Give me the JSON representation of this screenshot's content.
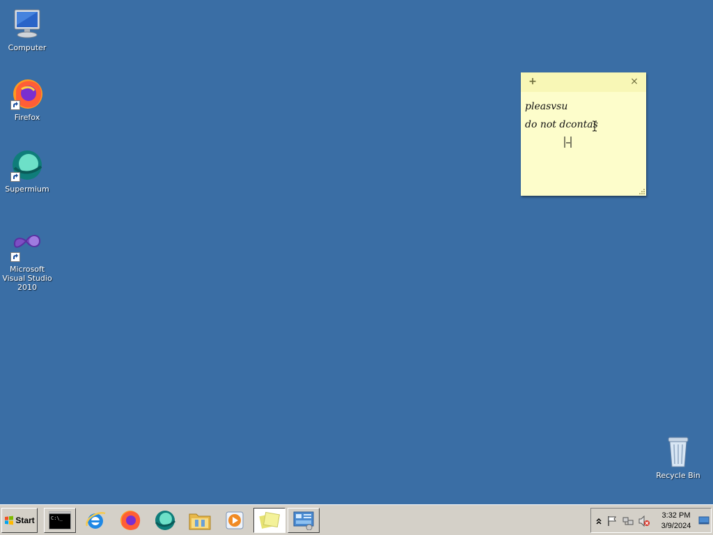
{
  "desktop": {
    "background": "#3a6ea5",
    "icons": [
      {
        "label": "Computer",
        "icon": "computer-icon",
        "shortcut": false
      },
      {
        "label": "Firefox",
        "icon": "firefox-icon",
        "shortcut": true
      },
      {
        "label": "Supermium",
        "icon": "supermium-icon",
        "shortcut": true
      },
      {
        "label": "Microsoft Visual Studio 2010",
        "icon": "visual-studio-icon",
        "shortcut": true
      },
      {
        "label": "Recycle Bin",
        "icon": "recycle-bin-icon",
        "shortcut": false
      }
    ]
  },
  "sticky_note": {
    "add_label": "+",
    "close_label": "×",
    "lines": [
      "pleasvsu",
      "do not dcontas"
    ],
    "background": "#fdfdcb"
  },
  "taskbar": {
    "start_label": "Start",
    "buttons": [
      {
        "name": "command-prompt",
        "icon": "cmd-icon",
        "state": "raised"
      },
      {
        "name": "internet-explorer",
        "icon": "ie-icon",
        "state": "flat"
      },
      {
        "name": "firefox",
        "icon": "firefox-icon",
        "state": "flat"
      },
      {
        "name": "supermium",
        "icon": "supermium-icon",
        "state": "flat"
      },
      {
        "name": "file-explorer",
        "icon": "folder-icon",
        "state": "flat"
      },
      {
        "name": "media-player",
        "icon": "media-player-icon",
        "state": "flat"
      },
      {
        "name": "sticky-notes",
        "icon": "sticky-notes-icon",
        "state": "pressed"
      },
      {
        "name": "control-panel",
        "icon": "control-panel-icon",
        "state": "raised"
      }
    ],
    "tray": {
      "time": "3:32 PM",
      "date": "3/9/2024",
      "icons": [
        "show-hidden-icon",
        "flag-icon",
        "network-icon",
        "volume-muted-icon",
        "show-desktop-icon"
      ]
    }
  }
}
